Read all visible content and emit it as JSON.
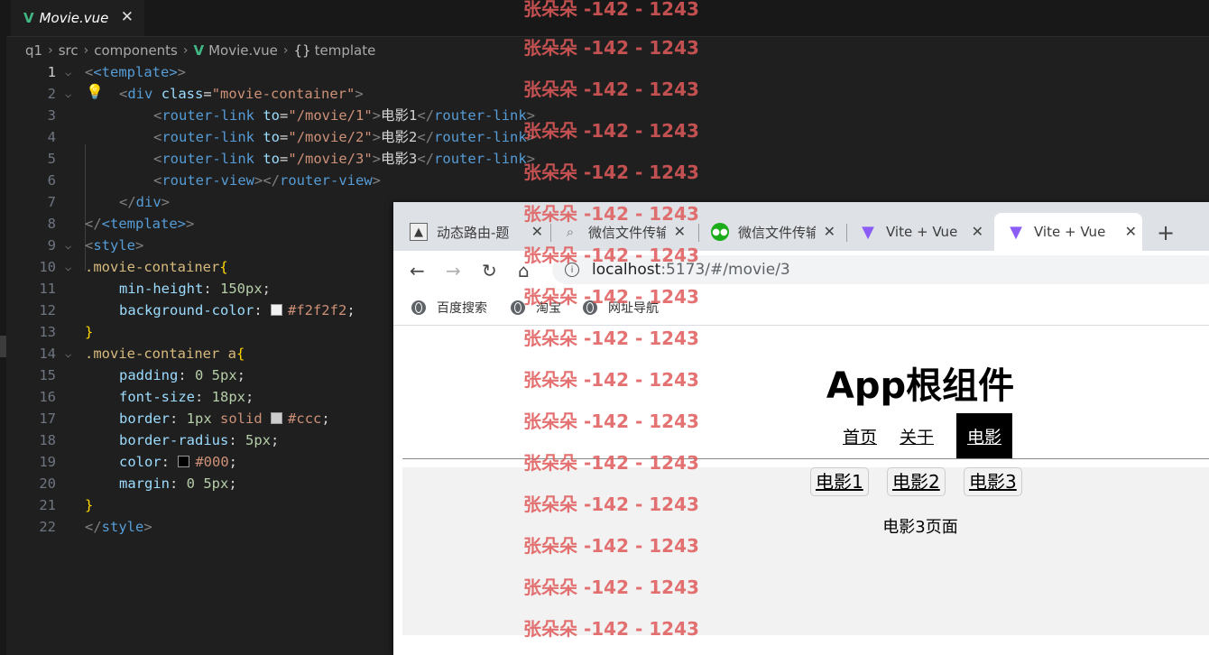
{
  "editor": {
    "tab_title": "Movie.vue",
    "breadcrumb": [
      "q1",
      "src",
      "components",
      "Movie.vue",
      "template"
    ]
  },
  "code_lines": [
    "1",
    "2",
    "3",
    "4",
    "5",
    "6",
    "7",
    "8",
    "9",
    "10",
    "11",
    "12",
    "13",
    "14",
    "15",
    "16",
    "17",
    "18",
    "19",
    "20",
    "21",
    "22"
  ],
  "code": {
    "l1": "<template>",
    "l2_tag": "div",
    "l2_attr": "class",
    "l2_val": "\"movie-container\"",
    "l3_to": "\"/movie/1\"",
    "l3_text": "电影1",
    "l4_to": "\"/movie/2\"",
    "l4_text": "电影2",
    "l5_to": "\"/movie/3\"",
    "l5_text": "电影3",
    "router_link": "router-link",
    "router_view": "router-view",
    "to_attr": "to",
    "l10_sel": ".movie-container",
    "l11_prop": "min-height",
    "l11_val": "150px",
    "l12_prop": "background-color",
    "l12_val": "#f2f2f2",
    "l14_sel": ".movie-container a",
    "l15_prop": "padding",
    "l15_val": "0 5px",
    "l16_prop": "font-size",
    "l16_val": "18px",
    "l17_prop": "border",
    "l17_val1": "1px",
    "l17_val2": "solid",
    "l17_val3": "#ccc",
    "l18_prop": "border-radius",
    "l18_val": "5px",
    "l19_prop": "color",
    "l19_val": "#000",
    "l20_prop": "margin",
    "l20_val": "0 5px"
  },
  "browser": {
    "tabs": [
      {
        "label": "动态路由-题"
      },
      {
        "label": "微信文件传输"
      },
      {
        "label": "微信文件传输"
      },
      {
        "label": "Vite + Vue"
      },
      {
        "label": "Vite + Vue"
      }
    ],
    "url_host": "localhost",
    "url_path": ":5173/#/movie/3",
    "bookmarks": [
      "百度搜索",
      "淘宝",
      "网址导航"
    ]
  },
  "page": {
    "title": "App根组件",
    "nav": [
      "首页",
      "关于",
      "电影"
    ],
    "movie_links": [
      "电影1",
      "电影2",
      "电影3"
    ],
    "movie_content": "电影3页面"
  },
  "watermark": "张朵朵 -142 - 1243"
}
